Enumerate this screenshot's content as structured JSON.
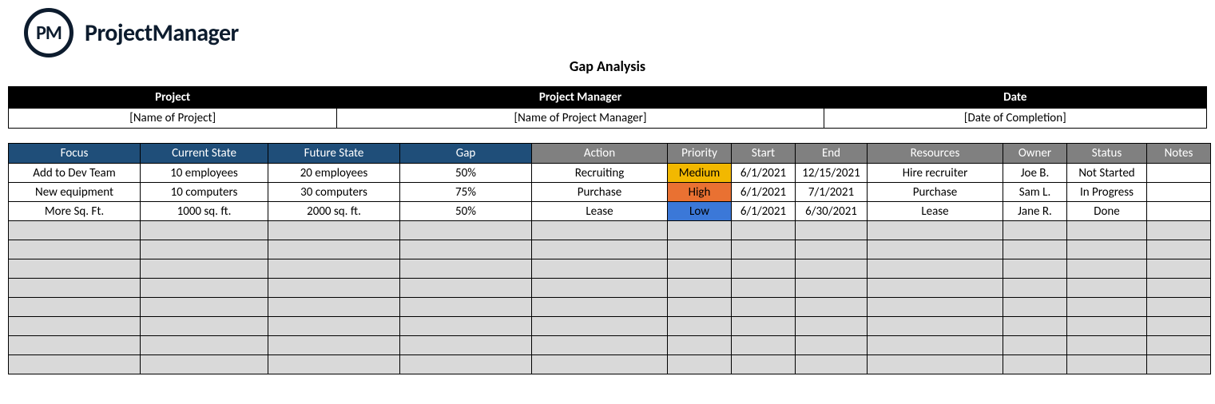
{
  "brand": {
    "abbr": "PM",
    "name": "ProjectManager"
  },
  "title": "Gap Analysis",
  "meta": {
    "headers": {
      "project": "Project",
      "manager": "Project Manager",
      "date": "Date"
    },
    "values": {
      "project": "[Name of Project]",
      "manager": "[Name of Project Manager]",
      "date": "[Date of Completion]"
    }
  },
  "columns": {
    "focus": "Focus",
    "current": "Current State",
    "future": "Future State",
    "gap": "Gap",
    "action": "Action",
    "priority": "Priority",
    "start": "Start",
    "end": "End",
    "resources": "Resources",
    "owner": "Owner",
    "status": "Status",
    "notes": "Notes"
  },
  "rows": [
    {
      "focus": "Add to Dev Team",
      "current": "10 employees",
      "future": "20 employees",
      "gap": "50%",
      "action": "Recruiting",
      "priority": "Medium",
      "priority_class": "prio-med",
      "start": "6/1/2021",
      "end": "12/15/2021",
      "resources": "Hire recruiter",
      "owner": "Joe B.",
      "status": "Not Started",
      "notes": ""
    },
    {
      "focus": "New equipment",
      "current": "10 computers",
      "future": "30 computers",
      "gap": "75%",
      "action": "Purchase",
      "priority": "High",
      "priority_class": "prio-high",
      "start": "6/1/2021",
      "end": "7/1/2021",
      "resources": "Purchase",
      "owner": "Sam L.",
      "status": "In Progress",
      "notes": ""
    },
    {
      "focus": "More Sq. Ft.",
      "current": "1000 sq. ft.",
      "future": "2000 sq. ft.",
      "gap": "50%",
      "action": "Lease",
      "priority": "Low",
      "priority_class": "prio-low",
      "start": "6/1/2021",
      "end": "6/30/2021",
      "resources": "Lease",
      "owner": "Jane R.",
      "status": "Done",
      "notes": ""
    }
  ],
  "empty_rows": 8
}
